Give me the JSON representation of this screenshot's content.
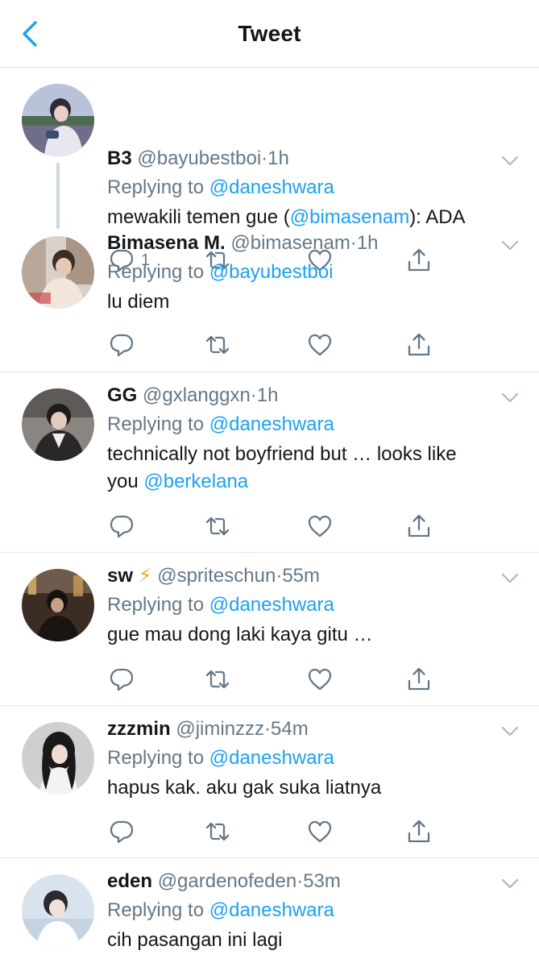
{
  "header": {
    "title": "Tweet"
  },
  "colors": {
    "accent": "#1da1f2",
    "muted": "#657786",
    "text": "#14171a",
    "divider": "#e1e8ed"
  },
  "tweets": [
    {
      "name": "B3",
      "handle": "@bayubestboi",
      "sep": "·",
      "time": "1h",
      "replying_to_label": "Replying to",
      "replying_to": "@daneshwara",
      "text_pre": "mewakili temen gue (",
      "text_mention": "@bimasenam",
      "text_post": "): ADA",
      "reply_count": "1"
    },
    {
      "name": "Bimasena M.",
      "handle": "@bimasenam",
      "sep": "·",
      "time": "1h",
      "replying_to_label": "Replying to",
      "replying_to": "@bayubestboi",
      "text": "lu diem"
    },
    {
      "name": "GG",
      "handle": "@gxlanggxn",
      "sep": "·",
      "time": "1h",
      "replying_to_label": "Replying to",
      "replying_to": "@daneshwara",
      "text_line1": "technically not boyfriend but … looks like",
      "text_line2_pre": "you ",
      "text_line2_mention": "@berkelana"
    },
    {
      "name": "sw",
      "name_emoji": "⚡",
      "handle": "@spriteschun",
      "sep": "·",
      "time": "55m",
      "replying_to_label": "Replying to",
      "replying_to": "@daneshwara",
      "text": "gue mau dong laki kaya gitu …"
    },
    {
      "name": "zzzmin",
      "handle": "@jiminzzz",
      "sep": "·",
      "time": "54m",
      "replying_to_label": "Replying to",
      "replying_to": "@daneshwara",
      "text": "hapus kak. aku gak suka liatnya"
    },
    {
      "name": "eden",
      "handle": "@gardenofeden",
      "sep": "·",
      "time": "53m",
      "replying_to_label": "Replying to",
      "replying_to": "@daneshwara",
      "text": "cih pasangan ini lagi"
    }
  ]
}
